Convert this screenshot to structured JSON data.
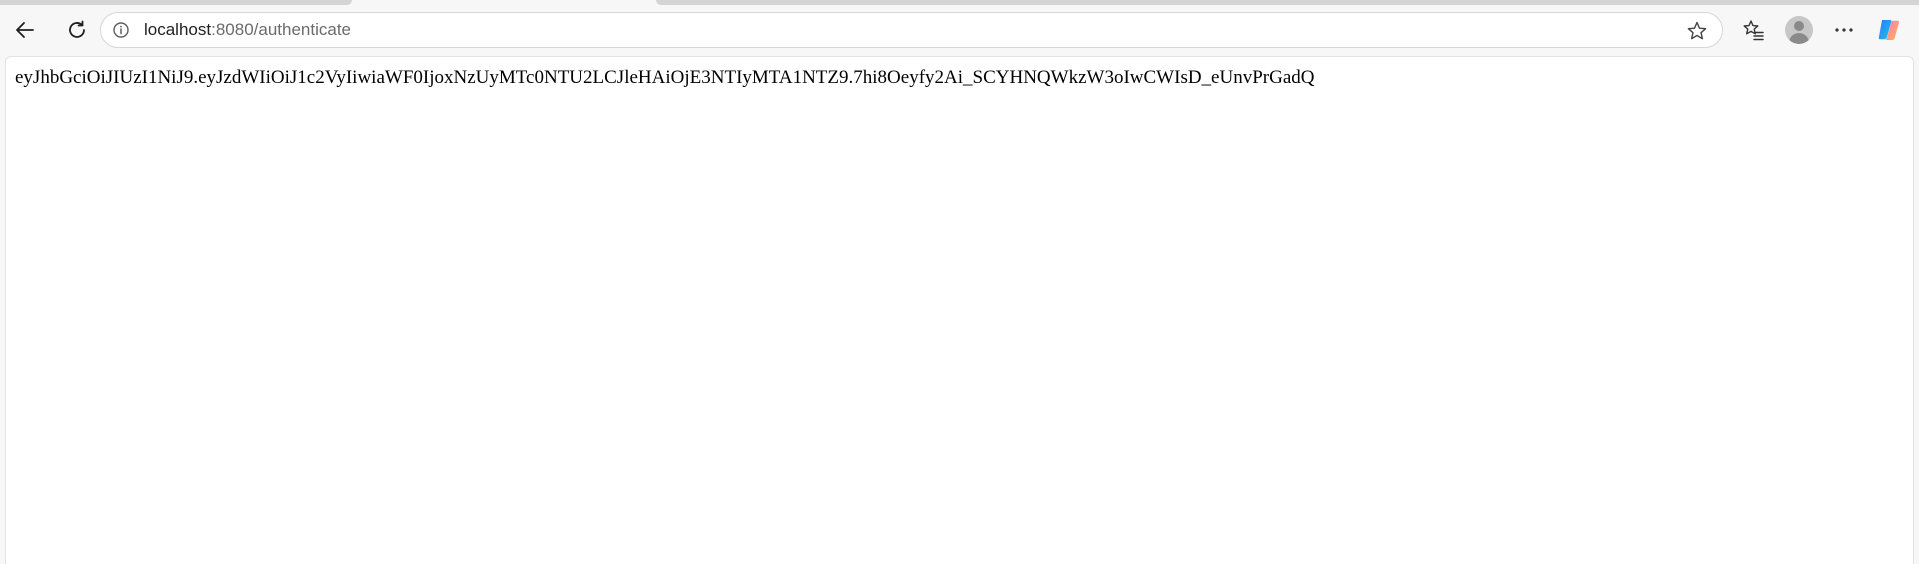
{
  "browser": {
    "address_bar": {
      "host": "localhost",
      "port_path": ":8080/authenticate"
    }
  },
  "icons": {
    "back": "back-arrow-icon",
    "reload": "reload-icon",
    "site_info": "info-icon",
    "favorite": "star-icon",
    "favorites_list": "favorites-icon",
    "profile": "avatar-icon",
    "menu": "more-icon",
    "copilot": "copilot-icon"
  },
  "colors": {
    "chrome_bg": "#f7f7f7",
    "page_bg": "#ffffff",
    "url_host": "#1f1f1f",
    "url_path": "#6b6b6b"
  },
  "page": {
    "body_text": "eyJhbGciOiJIUzI1NiJ9.eyJzdWIiOiJ1c2VyIiwiaWF0IjoxNzUyMTc0NTU2LCJleHAiOjE3NTIyMTA1NTZ9.7hi8Oeyfy2Ai_SCYHNQWkzW3oIwCWIsD_eUnvPrGadQ"
  }
}
